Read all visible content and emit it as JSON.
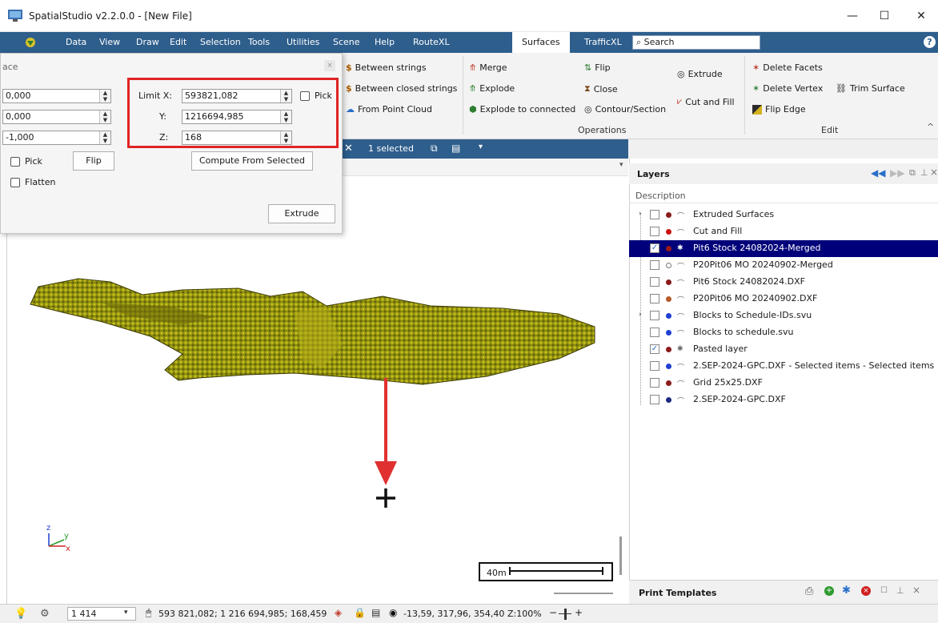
{
  "window": {
    "title": "SpatialStudio v2.2.0.0 - [New File]",
    "minimize": "—",
    "maximize": "☐",
    "close": "✕"
  },
  "menu": {
    "items": [
      "Data",
      "View",
      "Draw",
      "Edit",
      "Selection",
      "Tools",
      "Utilities",
      "Scene",
      "Help",
      "RouteXL",
      "Surfaces",
      "TrafficXL"
    ],
    "active": "Surfaces",
    "search_placeholder": "Search",
    "help": "?"
  },
  "ribbon": {
    "create": {
      "between_strings": "Between strings",
      "between_closed_strings": "Between closed strings",
      "from_point_cloud": "From Point Cloud"
    },
    "operations": {
      "merge": "Merge",
      "explode": "Explode",
      "explode_to_connected": "Explode to connected",
      "flip": "Flip",
      "close": "Close",
      "contour_section": "Contour/Section",
      "extrude": "Extrude",
      "cut_and_fill": "Cut and Fill",
      "group_label": "Operations"
    },
    "edit": {
      "delete_facets": "Delete Facets",
      "delete_vertex": "Delete Vertex",
      "trim_surface": "Trim Surface",
      "flip_edge": "Flip Edge",
      "group_label": "Edit"
    }
  },
  "toolbar2": {
    "selected": "1 selected"
  },
  "panel": {
    "title_fragment": "ace",
    "dir_x": "0,000",
    "dir_y": "0,000",
    "dir_z": "-1,000",
    "limit_x_label": "Limit X:",
    "limit_x": "593821,082",
    "y_label": "Y:",
    "limit_y": "1216694,985",
    "z_label": "Z:",
    "limit_z": "168",
    "pick_label": "Pick",
    "pick2_label": "Pick",
    "flatten_label": "Flatten",
    "flip_button": "Flip",
    "compute_button": "Compute From Selected",
    "extrude_button": "Extrude"
  },
  "layers": {
    "title": "Layers",
    "column": "Description",
    "items": [
      {
        "name": "Extruded Surfaces",
        "checked": false,
        "dot": "#8b1a1a",
        "expand": true,
        "selected": false
      },
      {
        "name": "Cut and Fill",
        "checked": false,
        "dot": "#cc1111",
        "expand": false,
        "selected": false
      },
      {
        "name": "Pit6 Stock 24082024-Merged",
        "checked": true,
        "dot": "#9a1a1a",
        "expand": false,
        "selected": true
      },
      {
        "name": "P20Pit06 MO 20240902-Merged",
        "checked": false,
        "dot": "#ffffff",
        "expand": false,
        "selected": false
      },
      {
        "name": "Pit6 Stock 24082024.DXF",
        "checked": false,
        "dot": "#8b1a1a",
        "expand": false,
        "selected": false
      },
      {
        "name": "P20Pit06 MO 20240902.DXF",
        "checked": false,
        "dot": "#b55a2a",
        "expand": false,
        "selected": false
      },
      {
        "name": "Blocks to Schedule-IDs.svu",
        "checked": false,
        "dot": "#1f3fd0",
        "expand": true,
        "selected": false
      },
      {
        "name": "Blocks to schedule.svu",
        "checked": false,
        "dot": "#1f3fd0",
        "expand": false,
        "selected": false
      },
      {
        "name": "Pasted layer",
        "checked": true,
        "dot": "#8b1a1a",
        "expand": false,
        "selected": false
      },
      {
        "name": "2.SEP-2024-GPC.DXF - Selected items - Selected items",
        "checked": false,
        "dot": "#1f3fd0",
        "expand": false,
        "selected": false
      },
      {
        "name": "Grid 25x25.DXF",
        "checked": false,
        "dot": "#8b1a1a",
        "expand": false,
        "selected": false
      },
      {
        "name": "2.SEP-2024-GPC.DXF",
        "checked": false,
        "dot": "#1b2a80",
        "expand": false,
        "selected": false
      }
    ]
  },
  "print_templates": {
    "title": "Print Templates"
  },
  "viewport": {
    "scale_label": "40m",
    "axis_z": "z",
    "axis_y": "y",
    "axis_x": "x"
  },
  "statusbar": {
    "count": "1 414",
    "coords": "593 821,082; 1 216 694,985; 168,459",
    "view": "-13,59, 317,96, 354,40",
    "zoom": "Z:100%"
  }
}
